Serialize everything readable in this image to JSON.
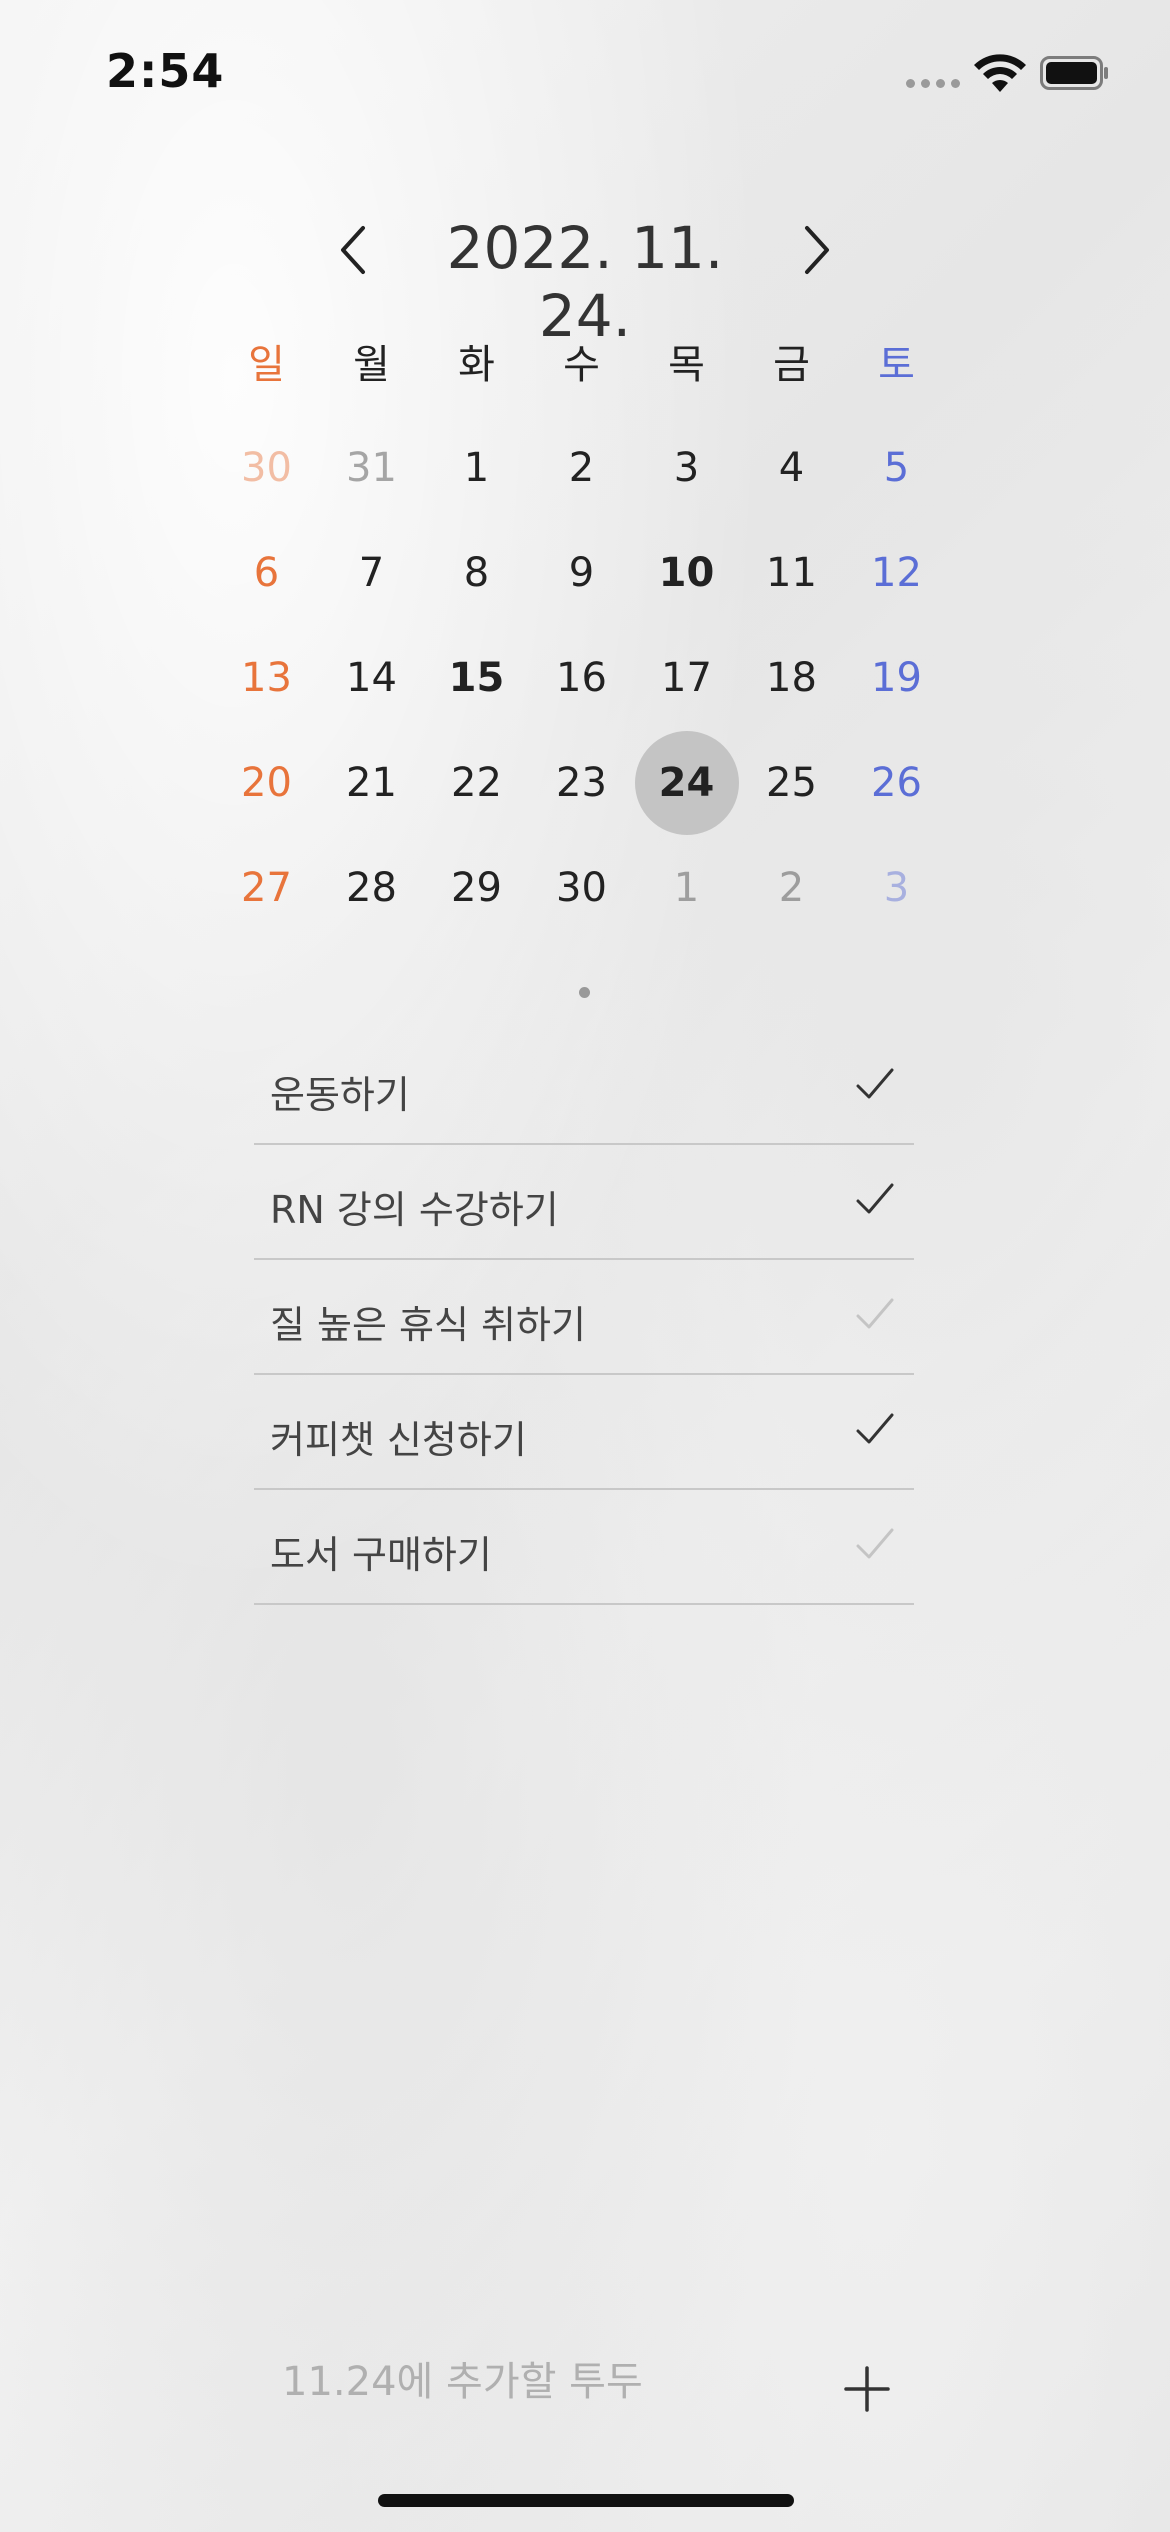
{
  "status_bar": {
    "time": "2:54"
  },
  "calendar": {
    "title": "2022. 11. 24.",
    "weekdays": [
      "일",
      "월",
      "화",
      "수",
      "목",
      "금",
      "토"
    ],
    "weeks": [
      [
        "30",
        "31",
        "1",
        "2",
        "3",
        "4",
        "5"
      ],
      [
        "6",
        "7",
        "8",
        "9",
        "10",
        "11",
        "12"
      ],
      [
        "13",
        "14",
        "15",
        "16",
        "17",
        "18",
        "19"
      ],
      [
        "20",
        "21",
        "22",
        "23",
        "24",
        "25",
        "26"
      ],
      [
        "27",
        "28",
        "29",
        "30",
        "1",
        "2",
        "3"
      ]
    ],
    "selected_day": "24",
    "colors": {
      "sunday": "#e8743b",
      "saturday": "#5b6ed6",
      "selected_bg": "#c4c4c4"
    }
  },
  "todos": [
    {
      "text": "운동하기",
      "done": true
    },
    {
      "text": "RN 강의 수강하기",
      "done": true
    },
    {
      "text": "질 높은 휴식 취하기",
      "done": false
    },
    {
      "text": "커피챗 신청하기",
      "done": true
    },
    {
      "text": "도서 구매하기",
      "done": false
    }
  ],
  "add_todo": {
    "placeholder": "11.24에 추가할 투두"
  }
}
